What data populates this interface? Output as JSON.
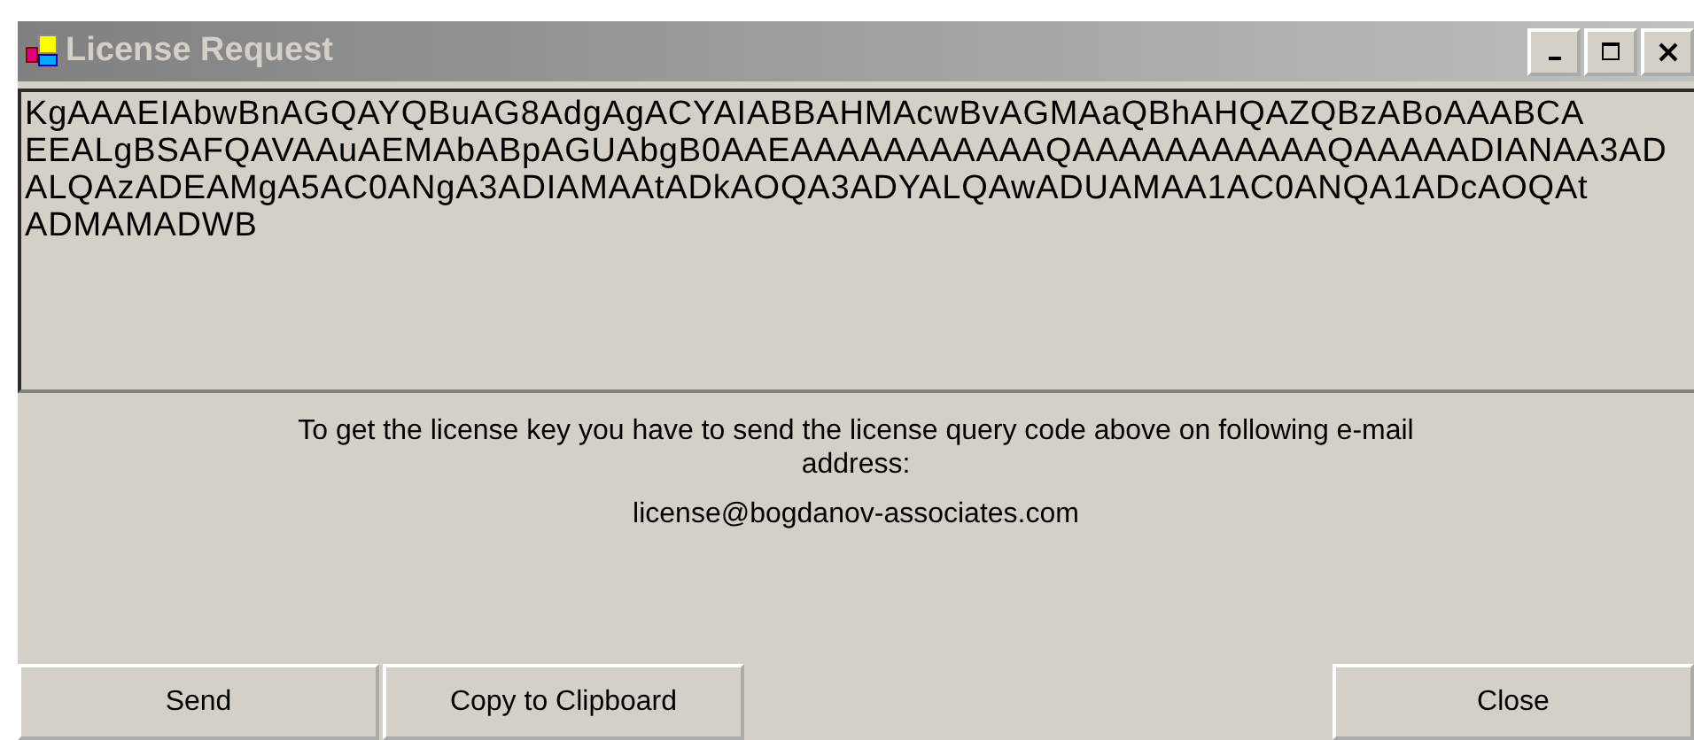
{
  "window": {
    "title": "License Request"
  },
  "query_code": {
    "lines": [
      "KgAAAEIAbwBnAGQAYQBuAG8AdgAgACYAIABBAHMAcwBvAGMAaQBhAHQAZQBzABoAAABCA",
      "EEALgBSAFQAVAAuAEMAbABpAGUAbgB0AAEAAAAAAAAAAAQAAAAAAAAAAAQAAAAADIANAA3AD",
      "ALQAzADEAMgA5AC0ANgA3ADIAMAAtADkAOQA3ADYALQAwADUAMAA1AC0ANQA1ADcAOQAt",
      "ADMAMADWB"
    ]
  },
  "message": "To get the license key you have to send the license query code above on following e-mail address:",
  "email": "license@bogdanov-associates.com",
  "buttons": [
    {
      "label": "Send",
      "kind": "left"
    },
    {
      "label": "Copy to Clipboard",
      "kind": "left"
    },
    {
      "label": "Close",
      "kind": "right"
    }
  ]
}
